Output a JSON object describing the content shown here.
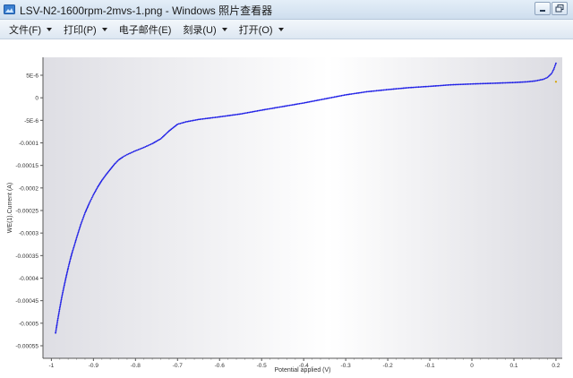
{
  "window": {
    "title": "LSV-N2-1600rpm-2mvs-1.png - Windows 照片查看器"
  },
  "menu": [
    {
      "label": "文件(F)",
      "has_dropdown": true
    },
    {
      "label": "打印(P)",
      "has_dropdown": true
    },
    {
      "label": "电子邮件(E)",
      "has_dropdown": false
    },
    {
      "label": "刻录(U)",
      "has_dropdown": true
    },
    {
      "label": "打开(O)",
      "has_dropdown": true
    }
  ],
  "icons": {
    "app": "photo-viewer-icon",
    "minimize": "minimize-icon",
    "restore": "restore-icon"
  },
  "colors": {
    "series": "#1f1fe6",
    "accent_point": "#d6a300",
    "plot_edge": "#dcdce3"
  },
  "chart_data": {
    "type": "scatter",
    "title": "",
    "xlabel": "Potential applied (V)",
    "ylabel": "WE(1).Current (A)",
    "xlim": [
      -1.02,
      0.215
    ],
    "ylim": [
      -0.000575,
      5.45e-05
    ],
    "x_ticks": [
      -1,
      -0.9,
      -0.8,
      -0.7,
      -0.6,
      -0.5,
      -0.4,
      -0.3,
      -0.2,
      -0.1,
      0,
      0.1,
      0.2
    ],
    "x_tick_labels": [
      "-1",
      "-0.9",
      "-0.8",
      "-0.7",
      "-0.6",
      "-0.5",
      "-0.4",
      "-0.3",
      "-0.2",
      "-0.1",
      "0",
      "0.1",
      "0.2"
    ],
    "y_ticks": [
      5e-06,
      0,
      -5e-06,
      -0.0001,
      -0.00015,
      -0.0002,
      -0.00025,
      -0.0003,
      -0.00035,
      -0.0004,
      -0.00045,
      -0.0005,
      -0.00055
    ],
    "y_tick_labels": [
      "5E-6",
      "0",
      "-5E-6",
      "-0.0001",
      "-0.00015",
      "-0.0002",
      "-0.00025",
      "-0.0003",
      "-0.00035",
      "-0.0004",
      "-0.00045",
      "-0.0005",
      "-0.00055"
    ],
    "series": [
      {
        "curve": [
          [
            -0.99,
            -0.000522
          ],
          [
            -0.985,
            -0.000495
          ],
          [
            -0.98,
            -0.00047
          ],
          [
            -0.975,
            -0.000446
          ],
          [
            -0.97,
            -0.000425
          ],
          [
            -0.965,
            -0.000405
          ],
          [
            -0.96,
            -0.000386
          ],
          [
            -0.955,
            -0.000368
          ],
          [
            -0.95,
            -0.000352
          ],
          [
            -0.945,
            -0.000338
          ],
          [
            -0.94,
            -0.000323
          ],
          [
            -0.935,
            -0.000309
          ],
          [
            -0.93,
            -0.000295
          ],
          [
            -0.925,
            -0.000283
          ],
          [
            -0.92,
            -0.000271
          ],
          [
            -0.915,
            -0.000261
          ],
          [
            -0.91,
            -0.000251
          ],
          [
            -0.905,
            -0.000242
          ],
          [
            -0.9,
            -0.000233
          ],
          [
            -0.895,
            -0.000225
          ],
          [
            -0.89,
            -0.000217
          ],
          [
            -0.885,
            -0.00021
          ],
          [
            -0.88,
            -0.000203
          ],
          [
            -0.87,
            -0.000191
          ],
          [
            -0.86,
            -0.00018
          ],
          [
            -0.85,
            -0.000169
          ],
          [
            -0.84,
            -0.00016
          ],
          [
            -0.83,
            -0.000154
          ],
          [
            -0.82,
            -0.000149
          ],
          [
            -0.8,
            -0.000141
          ],
          [
            -0.78,
            -0.000134
          ],
          [
            -0.76,
            -0.000126
          ],
          [
            -0.74,
            -0.000116
          ],
          [
            -0.72,
            -9.95e-05
          ],
          [
            -0.7,
            -8.55e-05
          ],
          [
            -0.68,
            -8.05e-05
          ],
          [
            -0.65,
            -7.55e-05
          ],
          [
            -0.6,
            -7e-05
          ],
          [
            -0.55,
            -6.4e-05
          ],
          [
            -0.5,
            -5.6e-05
          ],
          [
            -0.45,
            -4.85e-05
          ],
          [
            -0.4,
            -4.1e-05
          ],
          [
            -0.35,
            -3.25e-05
          ],
          [
            -0.3,
            -2.4e-05
          ],
          [
            -0.25,
            -1.75e-05
          ],
          [
            -0.2,
            -1.3e-05
          ],
          [
            -0.15,
            -9e-06
          ],
          [
            -0.1,
            -6.2e-06
          ],
          [
            -0.05,
            -3e-06
          ],
          [
            0.0,
            -1.2e-06
          ],
          [
            0.05,
            2e-07
          ],
          [
            0.1,
            1.8e-06
          ],
          [
            0.13,
            3.2e-06
          ],
          [
            0.15,
            5e-06
          ],
          [
            0.17,
            8.5e-06
          ],
          [
            0.18,
            1.25e-05
          ],
          [
            0.19,
            2.1e-05
          ],
          [
            0.195,
            3e-05
          ],
          [
            0.2,
            4.2e-05
          ]
        ]
      }
    ],
    "highlight_point": [
      0.2,
      3.5e-06
    ],
    "grid": false,
    "legend": "none"
  }
}
